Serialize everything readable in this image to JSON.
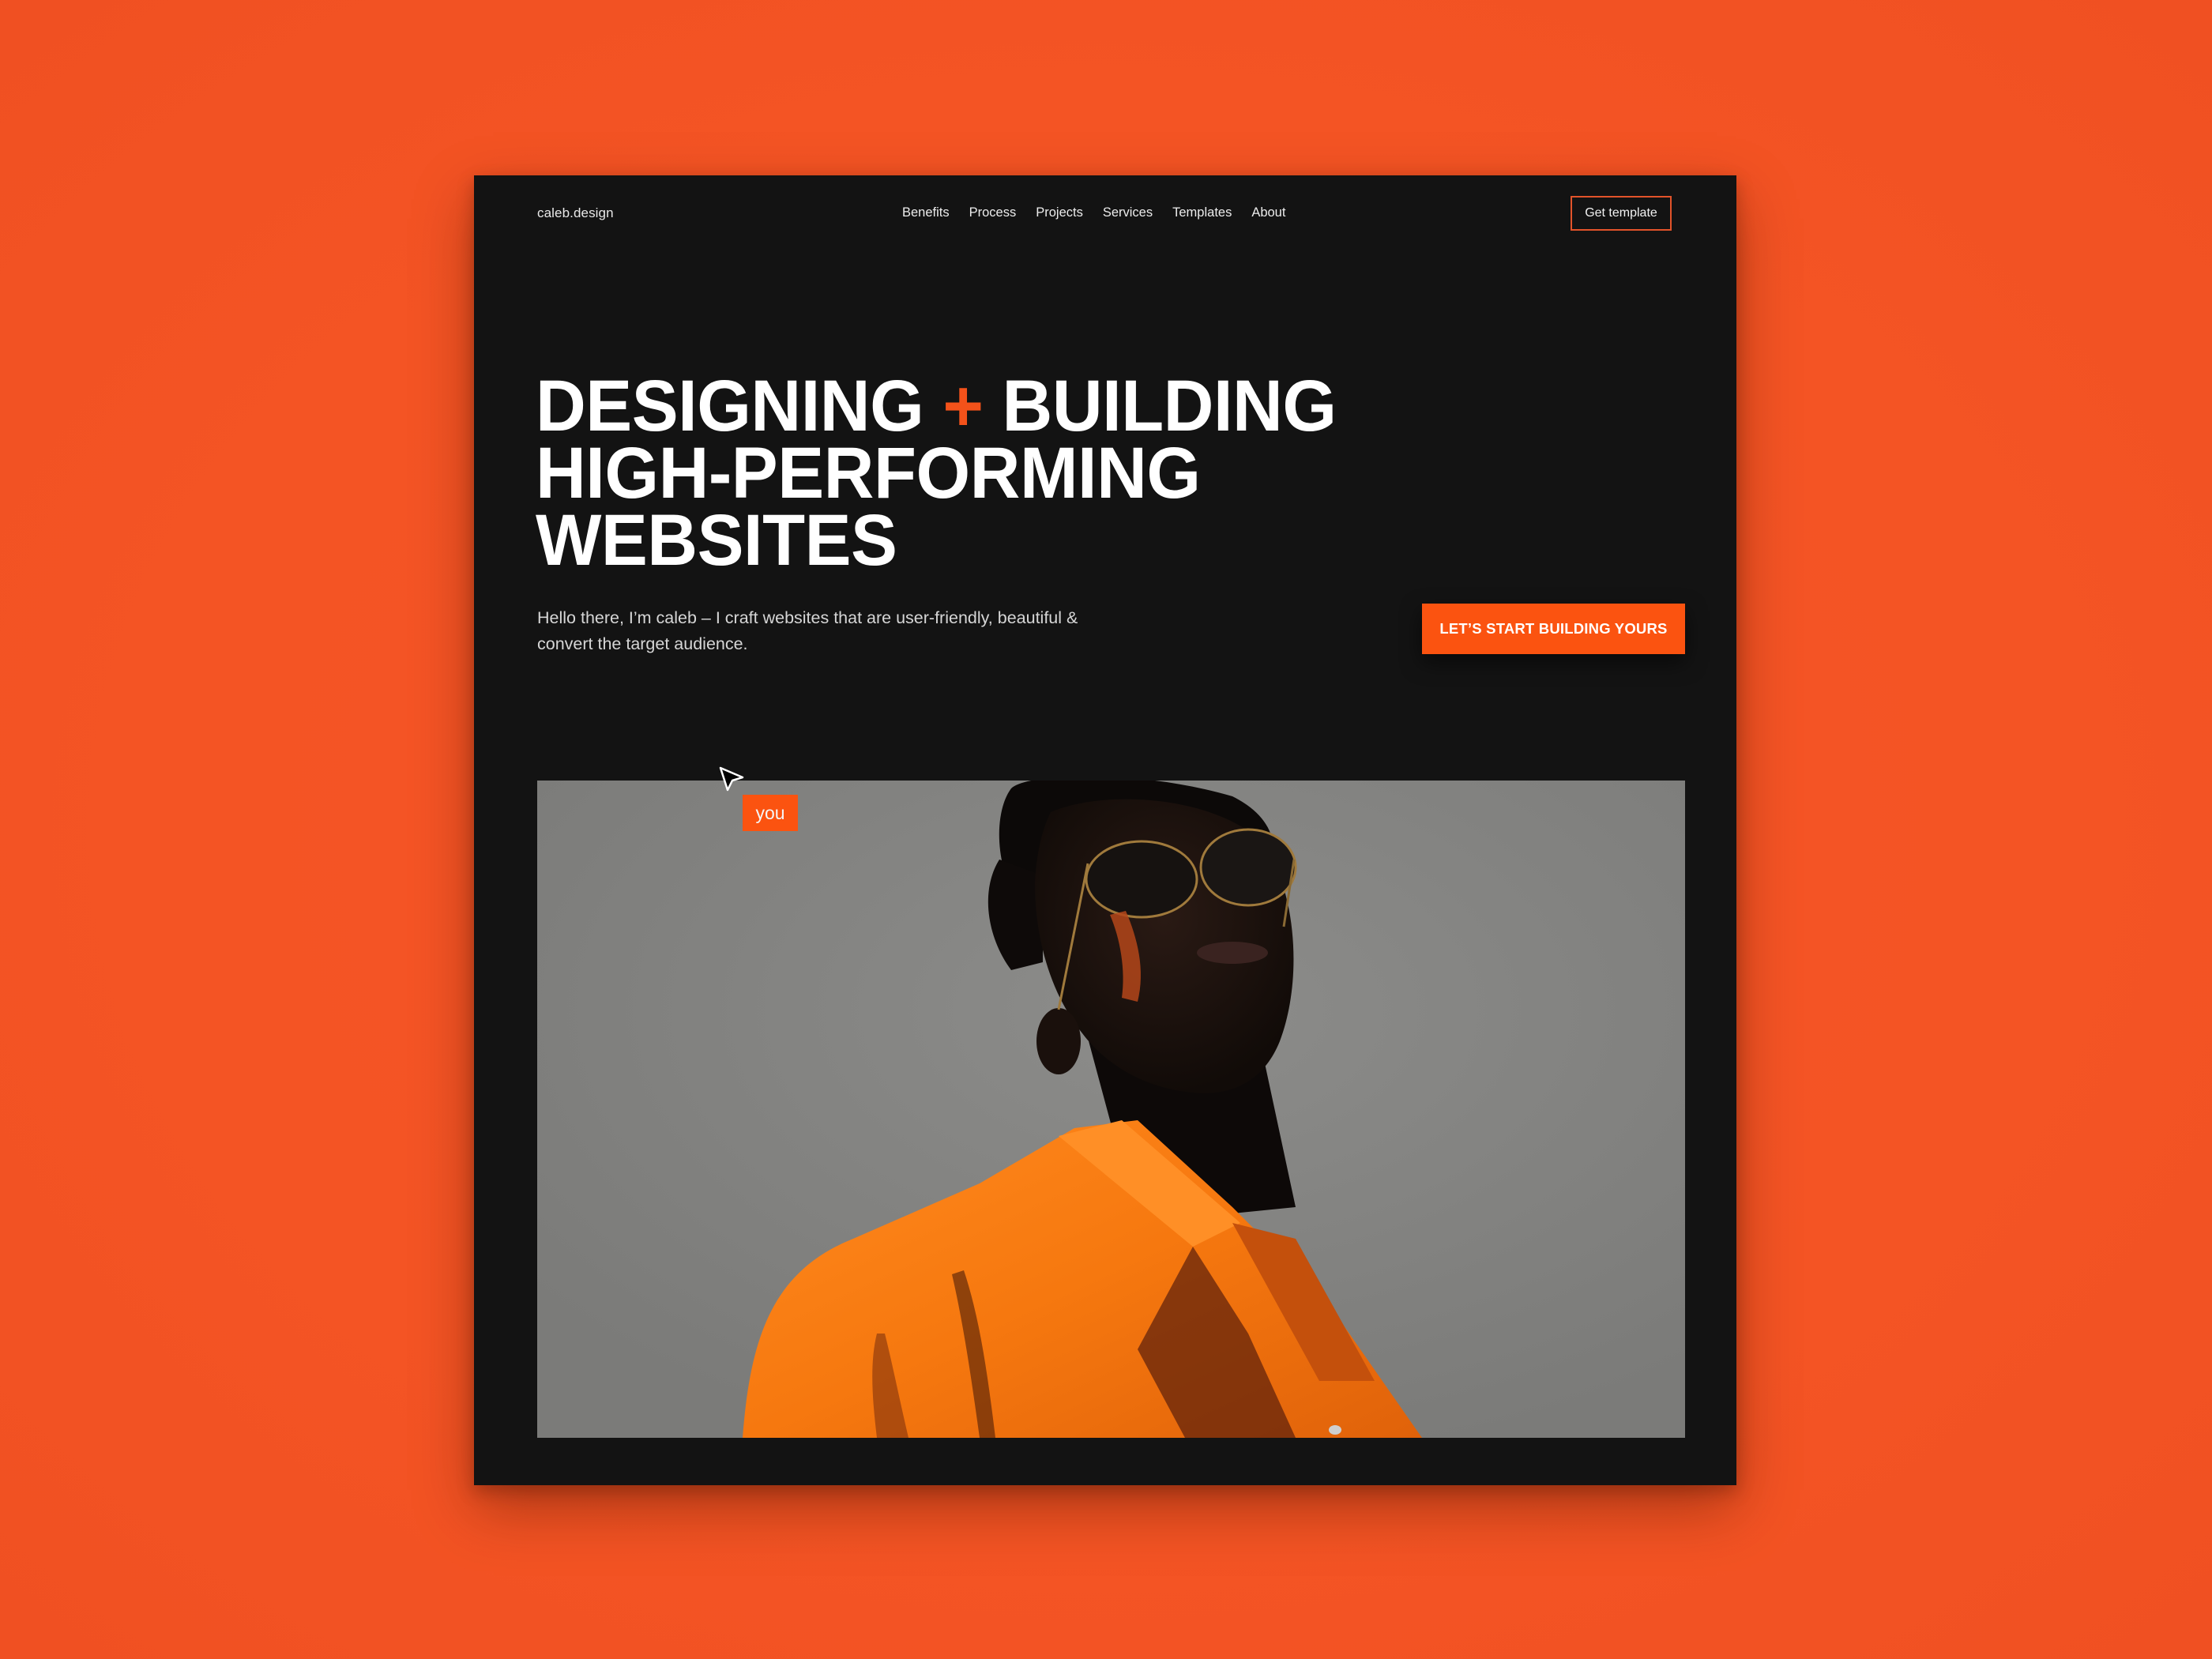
{
  "header": {
    "logo": "caleb.design",
    "nav": [
      {
        "label": "Benefits"
      },
      {
        "label": "Process"
      },
      {
        "label": "Projects"
      },
      {
        "label": "Services"
      },
      {
        "label": "Templates"
      },
      {
        "label": "About"
      }
    ],
    "cta_label": "Get template"
  },
  "hero": {
    "headline_line1_part1": "DESIGNING",
    "headline_plus": "+",
    "headline_line1_part2": "BUILDING",
    "headline_line2": "HIGH-PERFORMING",
    "headline_line3": "WEBSITES",
    "subtext": "Hello there, I’m caleb – I craft websites that are user-friendly, beautiful & convert the target audience.",
    "cta_label": "LET’S START BUILDING YOURS",
    "image_alt": "Portrait of a man in sunglasses and an orange jacket against a grey background"
  },
  "cursor_tag": {
    "label": "you"
  },
  "colors": {
    "background": "#f45424",
    "card": "#131313",
    "accent": "#fb5310",
    "text": "#ffffff",
    "muted_text": "#d6d6d6",
    "image_bg": "#838381"
  }
}
